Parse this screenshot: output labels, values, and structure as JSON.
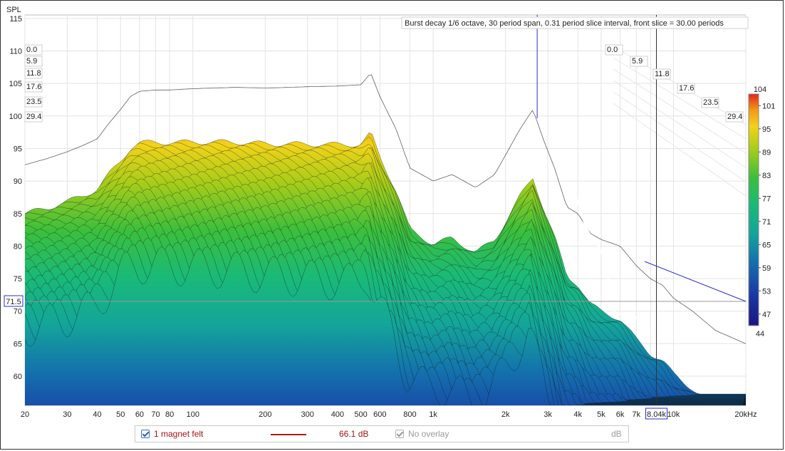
{
  "chart_data": {
    "type": "waterfall",
    "title": "Burst decay 1/6 octave, 30 period span, 0.31 period slice interval,  front slice = 30.00 periods",
    "ylabel": "SPL",
    "xunit": "kHz",
    "ylim": [
      55,
      115
    ],
    "y_ticks": [
      "115",
      "110",
      "105",
      "100",
      "95",
      "90",
      "85",
      "80",
      "75",
      "70",
      "65",
      "60"
    ],
    "x_ticks": [
      "20",
      "30",
      "40",
      "50",
      "60",
      "70",
      "80",
      "100",
      "200",
      "300",
      "400",
      "500",
      "600",
      "800",
      "1k",
      "2k",
      "3k",
      "4k",
      "5k",
      "6k",
      "7k",
      "8.04k",
      "10k",
      "20kHz"
    ],
    "period_labels_left": [
      "0.0",
      "5.9",
      "11.8",
      "17.6",
      "23.5",
      "29.4"
    ],
    "period_labels_right": [
      "0.0",
      "5.9",
      "11.8",
      "17.6",
      "23.5",
      "29.4"
    ],
    "cursor": {
      "frequency": "8.04k",
      "level": "71.5",
      "marker_freq_hz": 2600
    },
    "colorscale": {
      "max": "104",
      "min": "44",
      "labels": [
        "101",
        "95",
        "89",
        "83",
        "77",
        "71",
        "65",
        "59",
        "53",
        "47"
      ]
    },
    "front_slice": {
      "freq_hz": [
        20,
        25,
        30,
        35,
        40,
        45,
        50,
        55,
        60,
        70,
        80,
        100,
        150,
        200,
        250,
        300,
        400,
        500,
        550,
        600,
        700,
        800,
        1000,
        1200,
        1500,
        1800,
        2000,
        2300,
        2600,
        2900,
        3200,
        3600,
        4000,
        4500,
        5000,
        6000,
        7000,
        8000,
        9000,
        10000,
        12000,
        15000,
        20000
      ],
      "spl_db": [
        92.5,
        93.5,
        94.5,
        95.5,
        96.5,
        99,
        101,
        103,
        103.8,
        104,
        104,
        104.2,
        104.4,
        104.3,
        104.4,
        104.5,
        104.6,
        104.8,
        106.6,
        103,
        98,
        92,
        90,
        91,
        89,
        91,
        94,
        98,
        101,
        96,
        92,
        86,
        85,
        82,
        81,
        80,
        77,
        75,
        74,
        72,
        70,
        67,
        65
      ]
    },
    "decay_spl_db": [
      64,
      60,
      57
    ]
  },
  "legend": {
    "item1_label": "1 magnet felt",
    "item1_value": "66.1 dB",
    "item1_color": "#b01818",
    "item2_label": "No overlay",
    "item2_unit": "dB"
  }
}
